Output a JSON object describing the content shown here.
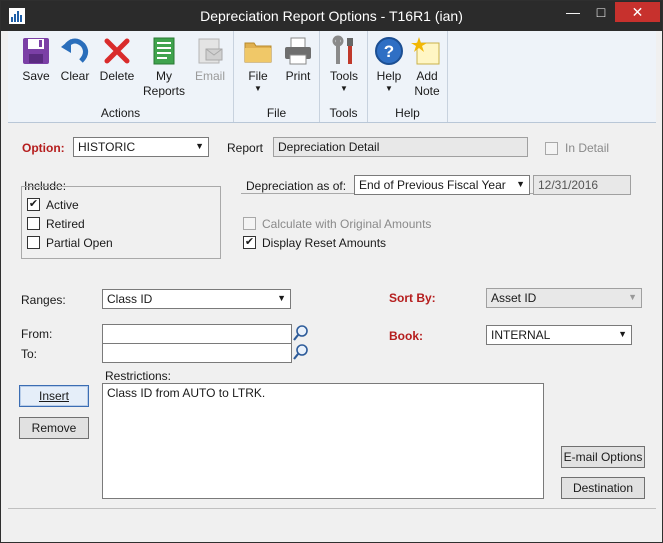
{
  "window": {
    "title": "Depreciation Report Options  -  T16R1 (ian)",
    "min_symbol": "—",
    "max_symbol": "□",
    "close_symbol": "✕"
  },
  "ribbon": {
    "groups": [
      {
        "label": "Actions",
        "buttons": [
          {
            "label": "Save",
            "icon": "save-icon"
          },
          {
            "label": "Clear",
            "icon": "clear-icon"
          },
          {
            "label": "Delete",
            "icon": "delete-icon"
          },
          {
            "label1": "My",
            "label2": "Reports",
            "icon": "my-reports-icon"
          },
          {
            "label": "Email",
            "icon": "email-icon",
            "disabled": true
          }
        ]
      },
      {
        "label": "File",
        "buttons": [
          {
            "label": "File",
            "icon": "folder-icon",
            "dropdown": true
          },
          {
            "label": "Print",
            "icon": "printer-icon"
          }
        ]
      },
      {
        "label": "Tools",
        "buttons": [
          {
            "label": "Tools",
            "icon": "tools-icon",
            "dropdown": true
          }
        ]
      },
      {
        "label": "Help",
        "buttons": [
          {
            "label": "Help",
            "icon": "help-icon",
            "dropdown": true
          },
          {
            "label1": "Add",
            "label2": "Note",
            "icon": "add-note-icon"
          }
        ]
      }
    ]
  },
  "form": {
    "option_label": "Option:",
    "option_value": "HISTORIC",
    "report_label": "Report",
    "report_value": "Depreciation Detail",
    "in_detail_label": "In Detail",
    "include_label": "Include:",
    "include_active": "Active",
    "include_retired": "Retired",
    "include_partial": "Partial Open",
    "depr_as_of_label": "Depreciation as of:",
    "depr_as_of_value": "End of Previous Fiscal Year",
    "depr_date": "12/31/2016",
    "calc_original_label": "Calculate with Original Amounts",
    "display_reset_label": "Display Reset Amounts",
    "ranges_label": "Ranges:",
    "ranges_value": "Class ID",
    "sort_by_label": "Sort By:",
    "sort_by_value": "Asset ID",
    "from_label": "From:",
    "to_label": "To:",
    "from_value": "",
    "to_value": "",
    "book_label": "Book:",
    "book_value": "INTERNAL",
    "restrictions_label": "Restrictions:",
    "restrictions_value": "Class ID from AUTO to LTRK.",
    "insert_button": "Insert",
    "remove_button": "Remove",
    "email_options_button": "E-mail Options",
    "destination_button": "Destination"
  }
}
